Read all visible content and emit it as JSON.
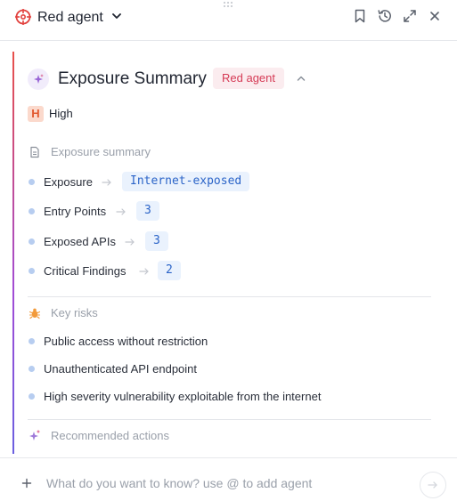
{
  "header": {
    "agent_name": "Red agent"
  },
  "summary": {
    "title": "Exposure Summary",
    "agent_pill": "Red agent",
    "severity_letter": "H",
    "severity_label": "High"
  },
  "exposure_section": {
    "label": "Exposure summary",
    "rows": [
      {
        "label": "Exposure",
        "value": "Internet-exposed"
      },
      {
        "label": "Entry Points",
        "value": "3"
      },
      {
        "label": "Exposed APIs",
        "value": "3"
      },
      {
        "label": "Critical Findings",
        "value": "2"
      }
    ]
  },
  "risks_section": {
    "label": "Key risks",
    "items": [
      "Public access without restriction",
      "Unauthenticated API endpoint",
      "High severity vulnerability exploitable from the internet"
    ]
  },
  "actions_section": {
    "label": "Recommended actions"
  },
  "composer": {
    "placeholder": "What do you want to know? use @ to add agent"
  },
  "colors": {
    "agent_red": "#e2423f",
    "pill_text": "#d53a55",
    "chip_text": "#2b64c8",
    "severity_high": "#e2592f"
  }
}
